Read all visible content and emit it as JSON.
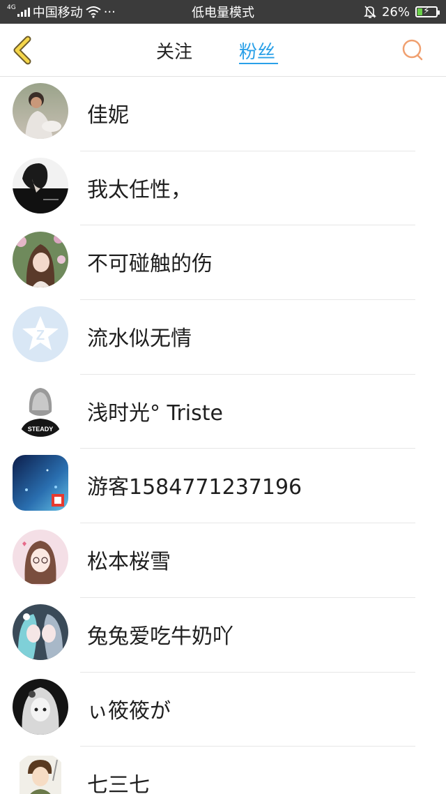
{
  "status_bar": {
    "network": "4G",
    "carrier": "中国移动",
    "more": "···",
    "mode": "低电量模式",
    "battery": "26%",
    "battery_level": 0.26
  },
  "header": {
    "back_icon": "chevron-left-icon",
    "tabs": [
      {
        "label": "关注",
        "active": false
      },
      {
        "label": "粉丝",
        "active": true
      }
    ],
    "search_icon": "search-icon",
    "accent_color": "#2aa0e8"
  },
  "fans": [
    {
      "name": "佳妮"
    },
    {
      "name": "我太任性，"
    },
    {
      "name": "不可碰触的伤"
    },
    {
      "name": "流水似无情"
    },
    {
      "name": "浅时光° Triste"
    },
    {
      "name": "游客1584771237196"
    },
    {
      "name": "松本桜雪"
    },
    {
      "name": "兔兔爱吃牛奶吖"
    },
    {
      "name": "ぃ筱筱が"
    },
    {
      "name": "七三七"
    }
  ]
}
